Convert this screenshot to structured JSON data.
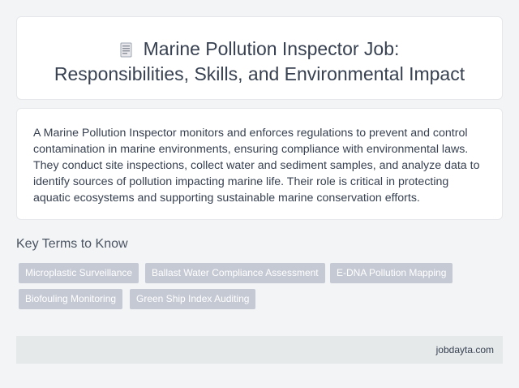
{
  "header": {
    "title_line1": "Marine Pollution Inspector Job:",
    "title_line2": "Responsibilities, Skills, and Environmental Impact",
    "icon": "document-icon"
  },
  "description": "A Marine Pollution Inspector monitors and enforces regulations to prevent and control contamination in marine environments, ensuring compliance with environmental laws. They conduct site inspections, collect water and sediment samples, and analyze data to identify sources of pollution impacting marine life. Their role is critical in protecting aquatic ecosystems and supporting sustainable marine conservation efforts.",
  "key_terms": {
    "heading": "Key Terms to Know",
    "items": [
      "Microplastic Surveillance",
      "Ballast Water Compliance Assessment",
      "E-DNA Pollution Mapping",
      "Biofouling Monitoring",
      "Green Ship Index Auditing"
    ]
  },
  "footer": {
    "site": "jobdayta.com"
  },
  "colors": {
    "tag_bg": "#c5c9d4",
    "page_bg": "#f3f4f6",
    "footer_bg": "#e5e9ea"
  }
}
